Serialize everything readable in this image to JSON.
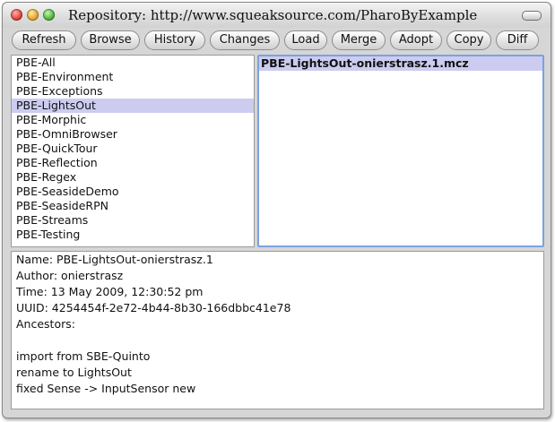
{
  "window": {
    "title": "Repository: http://www.squeaksource.com/PharoByExample"
  },
  "toolbar": {
    "buttons": [
      "Refresh",
      "Browse",
      "History",
      "Changes",
      "Load",
      "Merge",
      "Adopt",
      "Copy",
      "Diff"
    ]
  },
  "packages": {
    "items": [
      "PBE-All",
      "PBE-Environment",
      "PBE-Exceptions",
      "PBE-LightsOut",
      "PBE-Morphic",
      "PBE-OmniBrowser",
      "PBE-QuickTour",
      "PBE-Reflection",
      "PBE-Regex",
      "PBE-SeasideDemo",
      "PBE-SeasideRPN",
      "PBE-Streams",
      "PBE-Testing"
    ],
    "selected": "PBE-LightsOut"
  },
  "versions": {
    "items": [
      "PBE-LightsOut-onierstrasz.1.mcz"
    ],
    "selected": "PBE-LightsOut-onierstrasz.1.mcz"
  },
  "info": {
    "lines": [
      "Name: PBE-LightsOut-onierstrasz.1",
      "Author: onierstrasz",
      "Time: 13 May 2009, 12:30:52 pm",
      "UUID: 4254454f-2e72-4b44-8b30-166dbbc41e78",
      "Ancestors:",
      "",
      "import from SBE-Quinto",
      "rename to LightsOut",
      "fixed Sense -> InputSensor new"
    ]
  },
  "colors": {
    "selection": "#ccccf0",
    "focus_border": "#7aa2e0",
    "window_bg": "#d6d6d6"
  }
}
